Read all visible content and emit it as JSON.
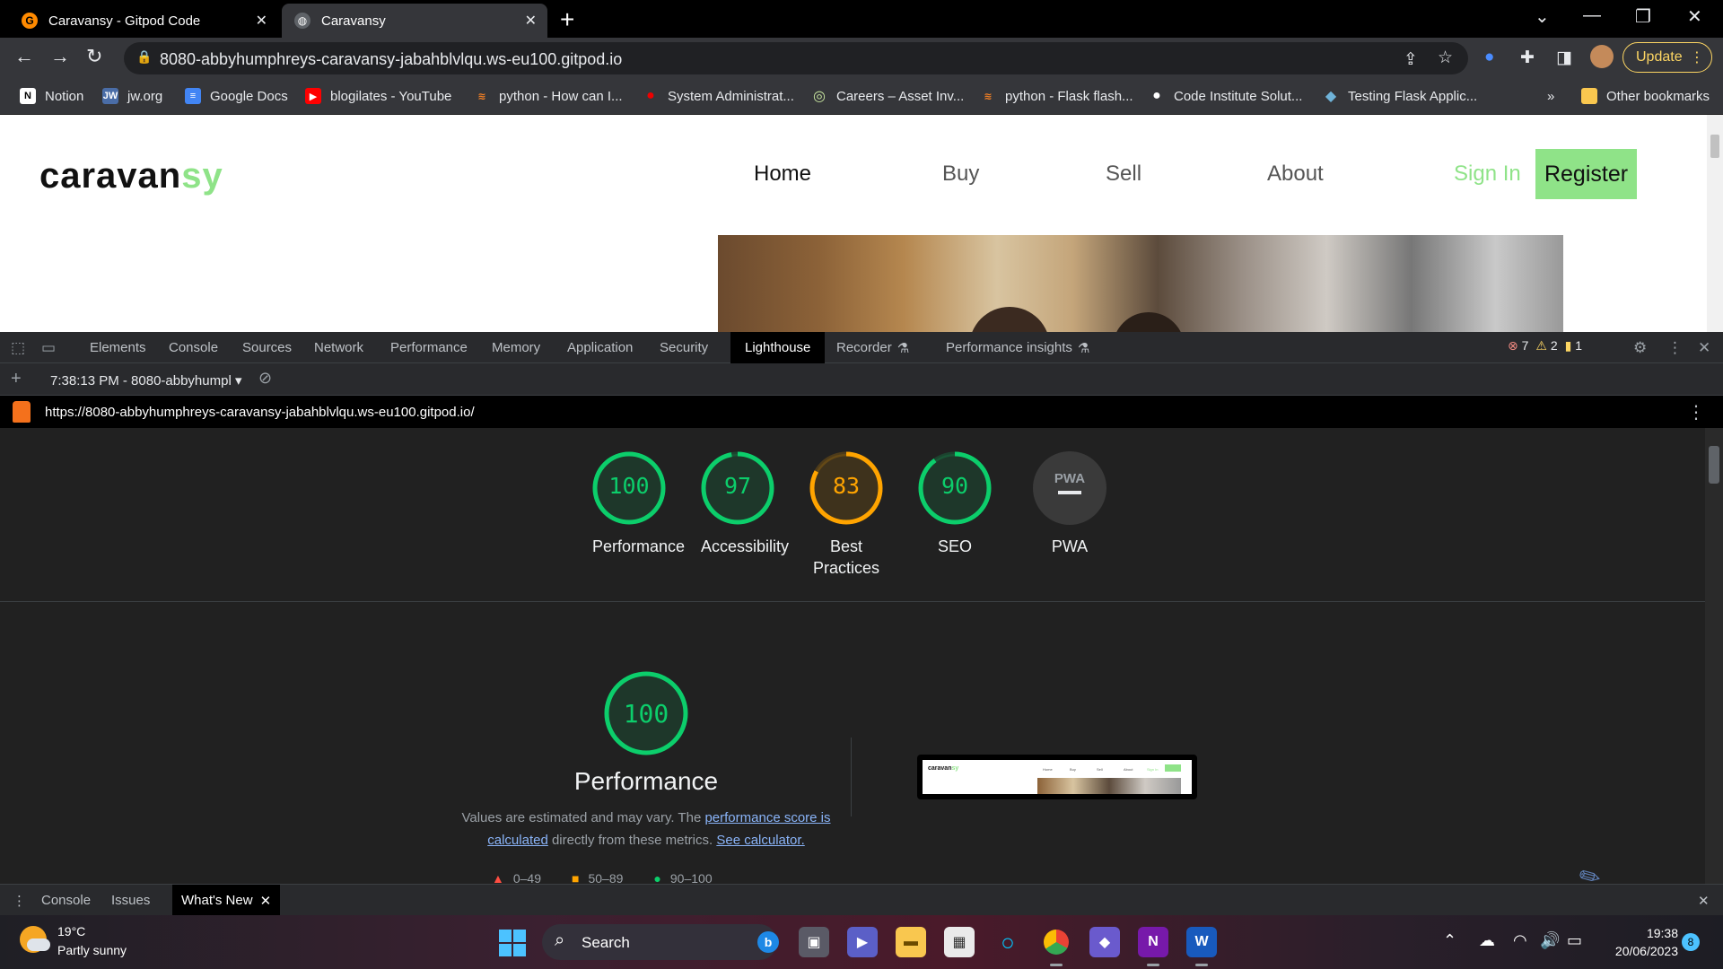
{
  "browser": {
    "tabs": [
      {
        "title": "Caravansy - Gitpod Code",
        "close": "✕"
      },
      {
        "title": "Caravansy",
        "close": "✕"
      }
    ],
    "new_tab": "+",
    "url": "8080-abbyhumphreys-caravansy-jabahblvlqu.ws-eu100.gitpod.io",
    "update_label": "Update",
    "bookmarks": [
      {
        "label": "Notion",
        "icon": "N",
        "color": "#ffffff",
        "fg": "#000000"
      },
      {
        "label": "jw.org",
        "icon": "JW",
        "color": "#4a6da7",
        "fg": "#ffffff"
      },
      {
        "label": "Google Docs",
        "icon": "≡",
        "color": "#4285f4",
        "fg": "#ffffff"
      },
      {
        "label": "blogilates - YouTube",
        "icon": "▶",
        "color": "#ff0000",
        "fg": "#ffffff"
      },
      {
        "label": "python - How can I...",
        "icon": "≋",
        "color": "#f48024",
        "fg": "#ffffff"
      },
      {
        "label": "System Administrat...",
        "icon": "●",
        "color": "#ee0000",
        "fg": "#ee0000"
      },
      {
        "label": "Careers – Asset Inv...",
        "icon": "◎",
        "color": "#c8e6a0",
        "fg": "#333333"
      },
      {
        "label": "python - Flask flash...",
        "icon": "≋",
        "color": "#f48024",
        "fg": "#ffffff"
      },
      {
        "label": "Code Institute Solut...",
        "icon": "●",
        "color": "#ffffff",
        "fg": "#000000"
      },
      {
        "label": "Testing Flask Applic...",
        "icon": "◆",
        "color": "#6fb3d9",
        "fg": "#ffffff"
      }
    ],
    "bookmarks_overflow": "»",
    "other_bookmarks": "Other bookmarks"
  },
  "site": {
    "logo_main": "caravan",
    "logo_accent": "sy",
    "nav": [
      "Home",
      "Buy",
      "Sell",
      "About"
    ],
    "sign_in": "Sign In",
    "register": "Register"
  },
  "devtools": {
    "tabs": [
      "Elements",
      "Console",
      "Sources",
      "Network",
      "Performance",
      "Memory",
      "Application",
      "Security",
      "Lighthouse",
      "Recorder",
      "Performance insights"
    ],
    "active_tab": "Lighthouse",
    "errors": "7",
    "warnings": "2",
    "info": "1",
    "report_select": "7:38:13 PM - 8080-abbyhumpl",
    "report_url": "https://8080-abbyhumphreys-caravansy-jabahblvlqu.ws-eu100.gitpod.io/",
    "drawer_tabs": [
      "Console",
      "Issues",
      "What's New"
    ]
  },
  "lighthouse": {
    "colors": {
      "pass": "#0cce6b",
      "average": "#ffa400",
      "fail": "#ff4e42"
    },
    "gauges": [
      {
        "score": 100,
        "label": "Performance",
        "level": "pass"
      },
      {
        "score": 97,
        "label": "Accessibility",
        "level": "pass"
      },
      {
        "score": 83,
        "label": "Best Practices",
        "level": "average"
      },
      {
        "score": 90,
        "label": "SEO",
        "level": "pass"
      }
    ],
    "pwa_label": "PWA",
    "pwa_badge": "PWA",
    "performance_title": "Performance",
    "performance_score": 100,
    "desc_prefix": "Values are estimated and may vary. The ",
    "desc_link1": "performance score is calculated",
    "desc_mid": " directly from these metrics. ",
    "desc_link2": "See calculator.",
    "legend": [
      "0–49",
      "50–89",
      "90–100"
    ]
  },
  "taskbar": {
    "temperature": "19°C",
    "condition": "Partly sunny",
    "search": "Search",
    "time": "19:38",
    "date": "20/06/2023",
    "notifications": "8"
  }
}
